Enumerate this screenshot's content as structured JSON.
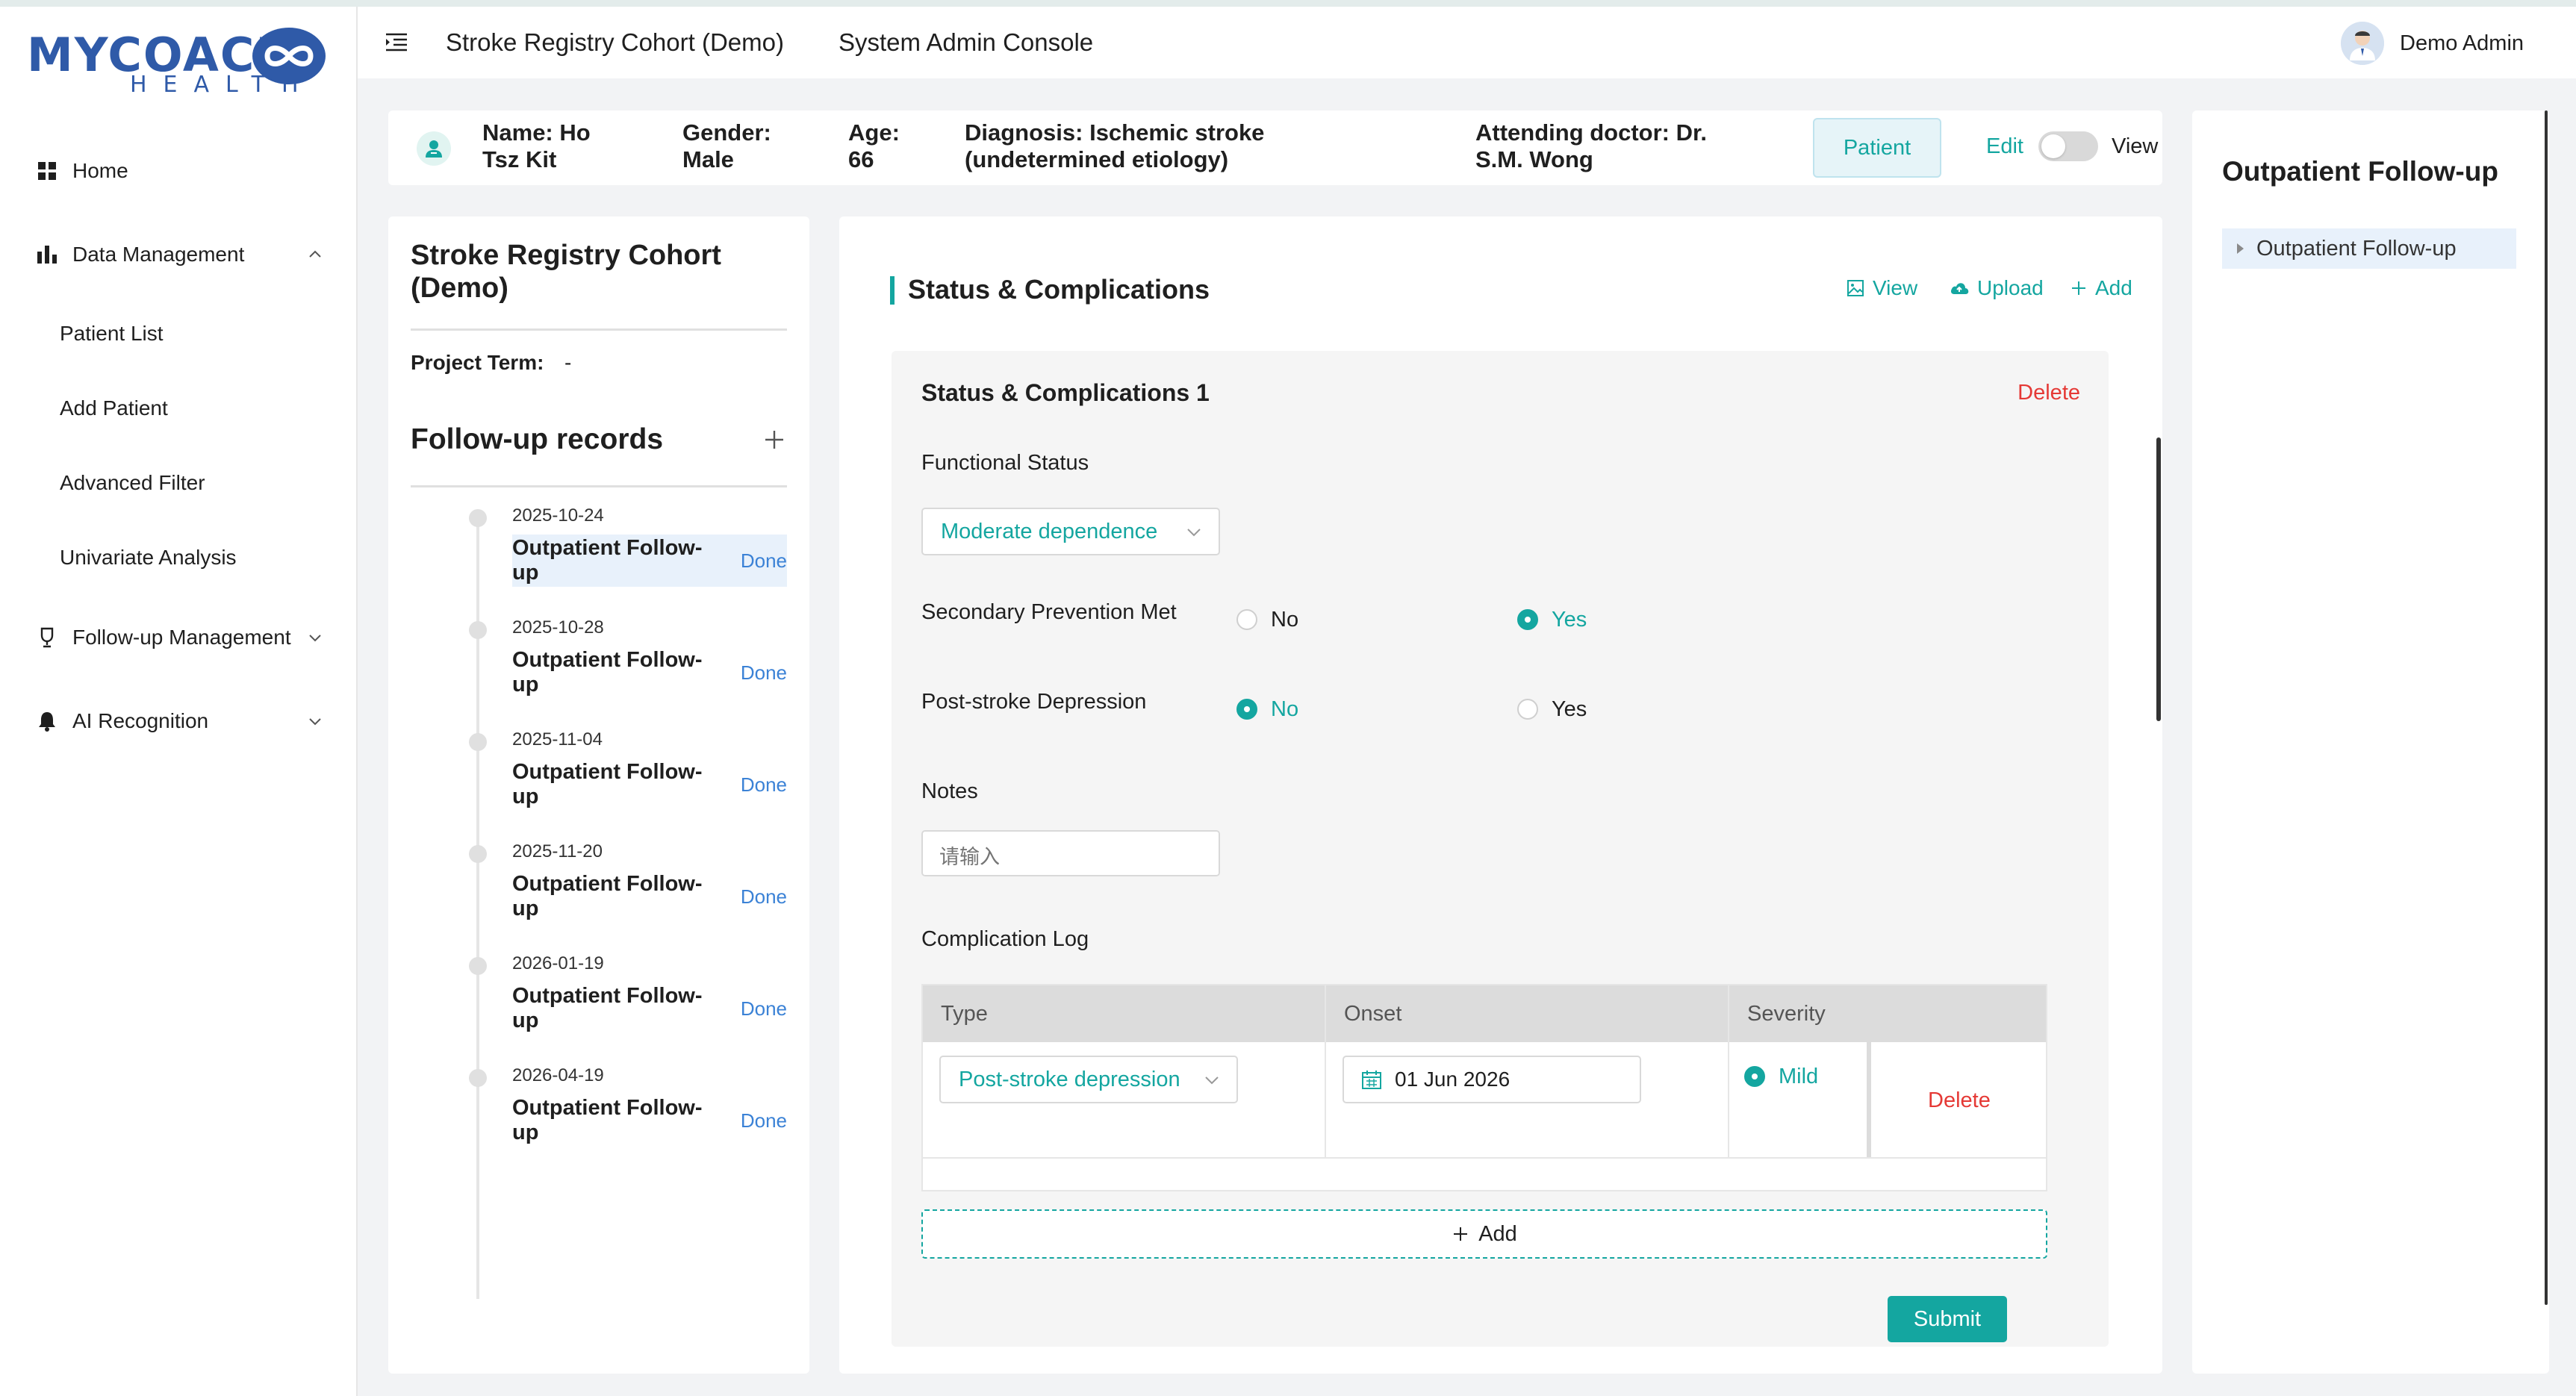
{
  "brand": {
    "name": "MYCOACH",
    "sub": "HEALTH",
    "accent": "#2f5aa8",
    "teal": "#14a6a0"
  },
  "sidebar": {
    "items": [
      {
        "label": "Home",
        "icon": "grid-icon"
      },
      {
        "label": "Data Management",
        "icon": "bar-chart-icon",
        "expanded": true
      },
      {
        "label": "Follow-up Management",
        "icon": "trophy-icon",
        "expanded": false
      },
      {
        "label": "AI Recognition",
        "icon": "bell-icon",
        "expanded": false
      }
    ],
    "sub_items": [
      "Patient List",
      "Add Patient",
      "Advanced Filter",
      "Univariate Analysis"
    ]
  },
  "header": {
    "title": "Stroke Registry Cohort (Demo)",
    "subtitle": "System Admin Console",
    "user": "Demo Admin"
  },
  "patient": {
    "name": "Name: Ho Tsz Kit",
    "gender": "Gender: Male",
    "age": "Age: 66",
    "diagnosis": "Diagnosis: Ischemic stroke (undetermined etiology)",
    "doctor": "Attending doctor: Dr. S.M. Wong",
    "patient_button": "Patient",
    "edit_label": "Edit",
    "view_label": "View",
    "toggle_on": false
  },
  "left_card": {
    "cohort_title": "Stroke Registry Cohort (Demo)",
    "term_label": "Project Term:",
    "term_value": "-",
    "followup_title": "Follow-up records",
    "records": [
      {
        "date": "2025-10-24",
        "name": "Outpatient Follow-up",
        "status": "Done",
        "active": true
      },
      {
        "date": "2025-10-28",
        "name": "Outpatient Follow-up",
        "status": "Done",
        "active": false
      },
      {
        "date": "2025-11-04",
        "name": "Outpatient Follow-up",
        "status": "Done",
        "active": false
      },
      {
        "date": "2025-11-20",
        "name": "Outpatient Follow-up",
        "status": "Done",
        "active": false
      },
      {
        "date": "2026-01-19",
        "name": "Outpatient Follow-up",
        "status": "Done",
        "active": false
      },
      {
        "date": "2026-04-19",
        "name": "Outpatient Follow-up",
        "status": "Done",
        "active": false
      }
    ]
  },
  "main": {
    "section_title": "Status & Complications",
    "actions": {
      "view": "View",
      "upload": "Upload",
      "add": "Add"
    },
    "card_title": "Status & Complications 1",
    "delete_label": "Delete",
    "functional_status_label": "Functional Status",
    "functional_status_value": "Moderate dependence",
    "secondary_prevention_label": "Secondary Prevention Met",
    "secondary_prevention_options": [
      "No",
      "Yes"
    ],
    "secondary_prevention_selected": "Yes",
    "depression_label": "Post-stroke Depression",
    "depression_options": [
      "No",
      "Yes"
    ],
    "depression_selected": "No",
    "notes_label": "Notes",
    "notes_placeholder": "请输入",
    "complication_log_label": "Complication Log",
    "table": {
      "headers": [
        "Type",
        "Onset",
        "Severity",
        ""
      ],
      "rows": [
        {
          "type": "Post-stroke depression",
          "onset": "01 Jun 2026",
          "severity": "Mild",
          "action": "Delete"
        }
      ]
    },
    "add_row_label": "Add",
    "submit_label": "Submit"
  },
  "right_panel": {
    "title": "Outpatient Follow-up",
    "tree_item": "Outpatient Follow-up"
  }
}
